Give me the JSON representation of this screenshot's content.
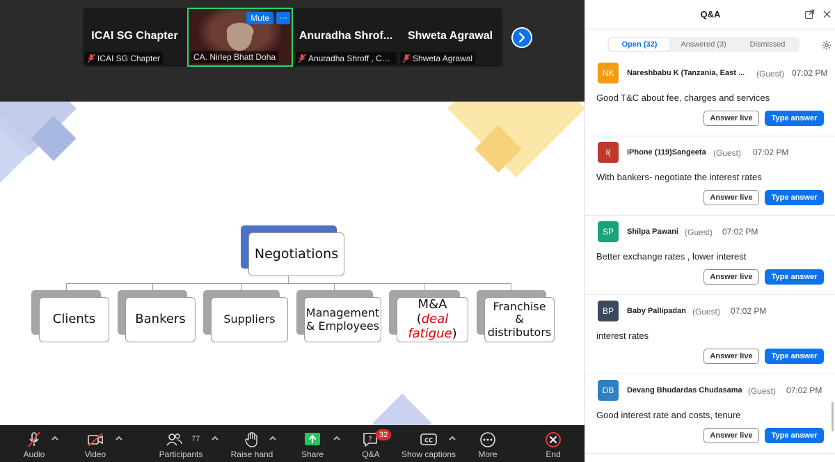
{
  "gallery": {
    "tiles": [
      {
        "name": "ICAI SG Chapter",
        "label": "ICAI SG Chapter"
      },
      {
        "name": "",
        "label": "CA. Nirlep Bhatt Doha",
        "mute_label": "Mute",
        "more_label": "···"
      },
      {
        "name": "Anuradha  Shrof...",
        "label": "Anuradha Shroff , Chai..."
      },
      {
        "name": "Shweta Agrawal",
        "label": "Shweta Agrawal"
      }
    ]
  },
  "slide": {
    "root": "Negotiations",
    "children": [
      "Clients",
      "Bankers",
      "Suppliers",
      "Management & Employees",
      "Franchise & distributors"
    ],
    "ma": {
      "prefix": "M&A",
      "open": "(",
      "italic1": "deal",
      "italic2": "fatigue",
      "close": ")"
    }
  },
  "toolbar": {
    "audio": "Audio",
    "video": "Video",
    "participants": "Participants",
    "participants_count": "77",
    "raise_hand": "Raise hand",
    "share": "Share",
    "qa": "Q&A",
    "qa_badge": "32",
    "captions": "Show captions",
    "more": "More",
    "end": "End"
  },
  "qa_panel": {
    "title": "Q&A",
    "tabs": [
      "Open (32)",
      "Answered (3)",
      "Dismissed"
    ],
    "answer_live": "Answer live",
    "type_answer": "Type answer",
    "questions": [
      {
        "initials": "NK",
        "color": "#f39c12",
        "author": "Nareshbabu K (Tanzania, East ...",
        "role": "(Guest)",
        "time": "07:02 PM",
        "text": "Good T&C about fee, charges and services"
      },
      {
        "initials": "I(",
        "color": "#c0392b",
        "author": "iPhone (119)Sangeeta",
        "role": "(Guest)",
        "time": "07:02 PM",
        "text": "With bankers- negotiate the interest rates"
      },
      {
        "initials": "SP",
        "color": "#1aa37a",
        "author": "Shilpa Pawani",
        "role": "(Guest)",
        "time": "07:02 PM",
        "text": "Better exchange rates , lower interest"
      },
      {
        "initials": "BP",
        "color": "#3a4a5c",
        "author": "Baby Pallipadan",
        "role": "(Guest)",
        "time": "07:02 PM",
        "text": "interest rates"
      },
      {
        "initials": "DB",
        "color": "#2f7fc1",
        "author": "Devang Bhudardas Chudasama",
        "role": "(Guest)",
        "time": "07:02 PM",
        "text": "Good interest rate and costs, tenure"
      }
    ]
  }
}
